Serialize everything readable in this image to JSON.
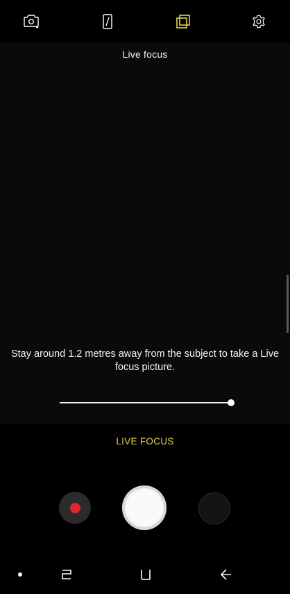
{
  "top_bar": {
    "icons": [
      {
        "name": "switch-camera-icon"
      },
      {
        "name": "aspect-ratio-icon"
      },
      {
        "name": "effects-icon",
        "color": "#e8d34c"
      },
      {
        "name": "settings-icon"
      }
    ]
  },
  "viewfinder": {
    "mode_title": "Live focus",
    "hint": "Stay around 1.2 metres away from the subject to take a Live focus picture.",
    "slider_level": 1.0
  },
  "mode": {
    "label": "LIVE FOCUS",
    "color": "#e8d34c"
  },
  "controls": {
    "record_color": "#e0272a",
    "shutter_color": "#f6f6f6"
  },
  "nav_bar": {
    "items": [
      "dot-indicator",
      "recent-apps-icon",
      "home-icon",
      "back-icon"
    ]
  }
}
